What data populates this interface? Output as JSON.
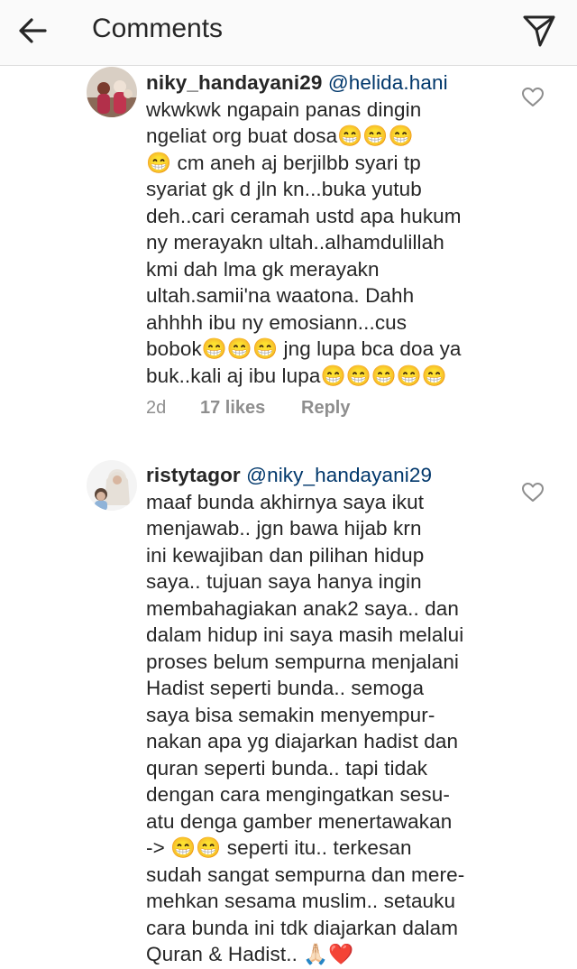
{
  "header": {
    "title": "Comments",
    "back_icon": "arrow-left-icon",
    "send_icon": "paper-plane-icon"
  },
  "comments": [
    {
      "username": "niky_handayani29",
      "mention": "@helida.hani",
      "text": "wkwkwk ngapain panas dingin\nngeliat org buat dosa😁😁😁\n😁 cm aneh aj berjilbb syari tp\nsyariat gk d jln kn...buka yutub\ndeh..cari ceramah ustd apa hukum\nny merayakn ultah..alhamdulillah\nkmi dah lma gk merayakn\nultah.samii'na waatona. Dahh\nahhhh ibu ny emosiann...cus\nbobok😁😁😁 jng lupa bca doa ya\nbuk..kali aj ibu lupa😁😁😁😁😁",
      "age": "2d",
      "likes": "17 likes",
      "reply": "Reply"
    },
    {
      "username": "ristytagor",
      "mention": "@niky_handayani29",
      "text": "maaf bunda akhirnya saya ikut\nmenjawab.. jgn bawa hijab krn\nini kewajiban dan pilihan hidup\nsaya.. tujuan saya hanya ingin\nmembahagiakan anak2 saya.. dan\ndalam hidup ini saya masih melalui\nproses belum sempurna menjalani\nHadist seperti bunda.. semoga\nsaya bisa semakin menyempur-\nnakan apa yg diajarkan hadist dan\nquran seperti bunda.. tapi tidak\ndengan cara mengingatkan sesu-\natu denga gamber menertawakan\n-> 😁😁 seperti itu.. terkesan\nsudah sangat sempurna dan mere-\nmehkan sesama muslim.. setauku\ncara bunda ini tdk diajarkan dalam\nQuran & Hadist.. 🙏🏻❤️"
    }
  ],
  "colors": {
    "text": "#262626",
    "mention": "#00376b",
    "meta": "#8e8e8e",
    "header_bg": "#fafafa",
    "divider": "#dbdbdb"
  }
}
